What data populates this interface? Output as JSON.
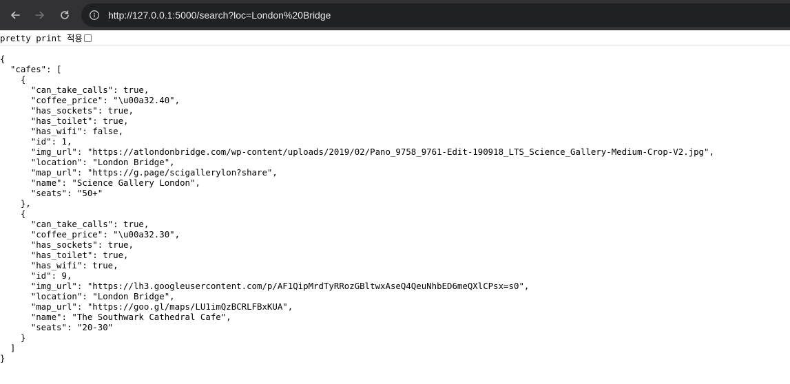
{
  "browser": {
    "url": "http://127.0.0.1:5000/search?loc=London%20Bridge",
    "icons": {
      "back": "arrow-left-icon",
      "forward": "arrow-right-icon",
      "reload": "reload-icon",
      "site_info": "info-circle-icon"
    },
    "colors": {
      "toolbar_bg": "#323234",
      "omnibox_bg": "#202124",
      "url_text": "#e8eaed"
    }
  },
  "page": {
    "pretty_print_label": "pretty print 적용",
    "pretty_print_checked": false,
    "json_lines": [
      "{",
      "  \"cafes\": [",
      "    {",
      "      \"can_take_calls\": true,",
      "      \"coffee_price\": \"\\u00a32.40\",",
      "      \"has_sockets\": true,",
      "      \"has_toilet\": true,",
      "      \"has_wifi\": false,",
      "      \"id\": 1,",
      "      \"img_url\": \"https://atlondonbridge.com/wp-content/uploads/2019/02/Pano_9758_9761-Edit-190918_LTS_Science_Gallery-Medium-Crop-V2.jpg\",",
      "      \"location\": \"London Bridge\",",
      "      \"map_url\": \"https://g.page/scigallerylon?share\",",
      "      \"name\": \"Science Gallery London\",",
      "      \"seats\": \"50+\"",
      "    },",
      "    {",
      "      \"can_take_calls\": true,",
      "      \"coffee_price\": \"\\u00a32.30\",",
      "      \"has_sockets\": true,",
      "      \"has_toilet\": true,",
      "      \"has_wifi\": true,",
      "      \"id\": 9,",
      "      \"img_url\": \"https://lh3.googleusercontent.com/p/AF1QipMrdTyRRozGBltwxAseQ4QeuNhbED6meQXlCPsx=s0\",",
      "      \"location\": \"London Bridge\",",
      "      \"map_url\": \"https://goo.gl/maps/LU1imQzBCRLFBxKUA\",",
      "      \"name\": \"The Southwark Cathedral Cafe\",",
      "      \"seats\": \"20-30\"",
      "    }",
      "  ]",
      "}"
    ]
  }
}
